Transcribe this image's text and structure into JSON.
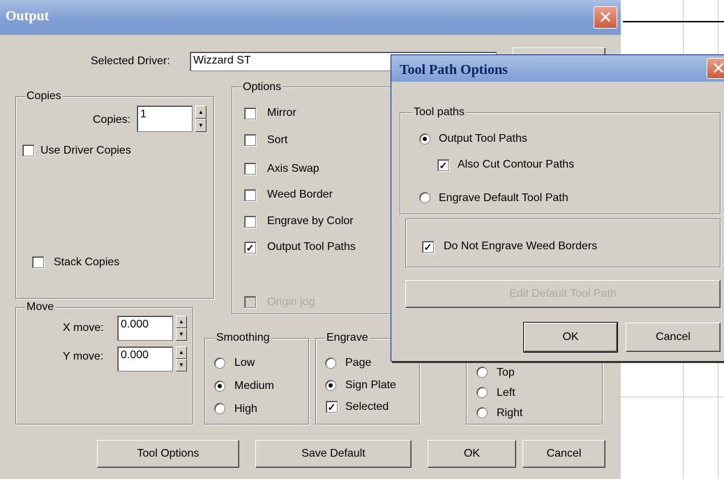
{
  "main_dialog": {
    "title": "Output",
    "driver_label": "Selected Driver:",
    "driver_value": "Wizzard ST",
    "copies_group": {
      "title": "Copies",
      "copies_label": "Copies:",
      "copies_value": "1",
      "use_driver_copies": {
        "label": "Use Driver Copies",
        "checked": false
      },
      "stack_copies": {
        "label": "Stack Copies",
        "checked": false
      }
    },
    "options_group": {
      "title": "Options",
      "items": [
        {
          "label": "Mirror",
          "checked": false
        },
        {
          "label": "Sort",
          "checked": false
        },
        {
          "label": "Axis Swap",
          "checked": false
        },
        {
          "label": "Weed Border",
          "checked": false
        },
        {
          "label": "Engrave by Color",
          "checked": false
        },
        {
          "label": "Output Tool Paths",
          "checked": true
        }
      ],
      "origin_jog": {
        "label": "Origin jog",
        "checked": false,
        "disabled": true
      }
    },
    "move_group": {
      "title": "Move",
      "x_label": "X move:",
      "x_value": "0.000",
      "y_label": "Y move:",
      "y_value": "0.000"
    },
    "smoothing_group": {
      "title": "Smoothing",
      "options": [
        "Low",
        "Medium",
        "High"
      ],
      "selected": "Medium"
    },
    "engrave_group": {
      "title": "Engrave",
      "options": [
        "Page",
        "Sign Plate"
      ],
      "selected": "Sign Plate",
      "selected_checkbox": {
        "label": "Selected",
        "checked": true
      }
    },
    "position_group": {
      "options": [
        "Top",
        "Left",
        "Right"
      ]
    },
    "buttons": {
      "tool_options": "Tool Options",
      "save_default": "Save Default",
      "ok": "OK",
      "cancel": "Cancel"
    }
  },
  "tool_path_dialog": {
    "title": "Tool Path Options",
    "tool_paths_group": {
      "title": "Tool paths",
      "output_tool_paths": {
        "label": "Output Tool Paths",
        "selected": true
      },
      "also_cut_contour": {
        "label": "Also Cut Contour Paths",
        "checked": true
      },
      "engrave_default": {
        "label": "Engrave Default Tool Path",
        "selected": false
      }
    },
    "do_not_engrave_weed": {
      "label": "Do Not Engrave Weed Borders",
      "checked": true
    },
    "edit_default_button": "Edit Default Tool Path",
    "ok": "OK",
    "cancel": "Cancel"
  },
  "colors": {
    "dialog_bg": "#d4d0c8",
    "title_gradient": "#7f9fd4",
    "close_red": "#cf5a3e"
  },
  "icons": [
    "close-icon",
    "check-icon",
    "spin-up-icon",
    "spin-down-icon"
  ]
}
